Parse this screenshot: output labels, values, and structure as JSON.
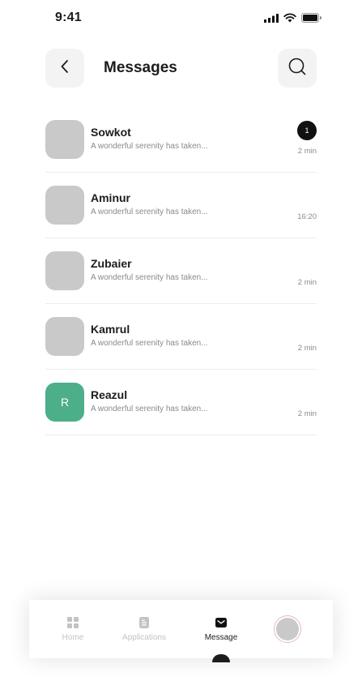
{
  "status_bar": {
    "time": "9:41",
    "icons": [
      "signal-icon",
      "wifi-icon",
      "battery-icon"
    ]
  },
  "header": {
    "title": "Messages",
    "back_icon": "chevron-left-icon",
    "search_icon": "search-icon"
  },
  "messages": [
    {
      "name": "Sowkot",
      "preview": "A wonderful serenity has taken...",
      "time": "2 min",
      "unread": "1",
      "avatar_text": "",
      "avatar_color": "#c9c9c9"
    },
    {
      "name": "Aminur",
      "preview": "A wonderful serenity has taken...",
      "time": "16:20",
      "unread": "",
      "avatar_text": "",
      "avatar_color": "#c9c9c9"
    },
    {
      "name": "Zubaier",
      "preview": "A wonderful serenity has taken...",
      "time": "2 min",
      "unread": "",
      "avatar_text": "",
      "avatar_color": "#c9c9c9"
    },
    {
      "name": "Kamrul",
      "preview": "A wonderful serenity has taken...",
      "time": "2 min",
      "unread": "",
      "avatar_text": "",
      "avatar_color": "#c9c9c9"
    },
    {
      "name": "Reazul",
      "preview": "A wonderful serenity has taken...",
      "time": "2 min",
      "unread": "",
      "avatar_text": "R",
      "avatar_color": "#4caf8a"
    }
  ],
  "bottom_nav": {
    "items": [
      {
        "label": "Home",
        "icon": "grid-icon",
        "active": false
      },
      {
        "label": "Applications",
        "icon": "document-icon",
        "active": false
      },
      {
        "label": "Message",
        "icon": "envelope-icon",
        "active": true
      },
      {
        "label": "",
        "icon": "profile-avatar",
        "active": false
      }
    ]
  },
  "colors": {
    "accent": "#111111",
    "inactive_nav": "#c3c3c3",
    "avatar_placeholder": "#c9c9c9",
    "avatar_green": "#4caf8a",
    "button_bg": "#f3f3f3"
  }
}
